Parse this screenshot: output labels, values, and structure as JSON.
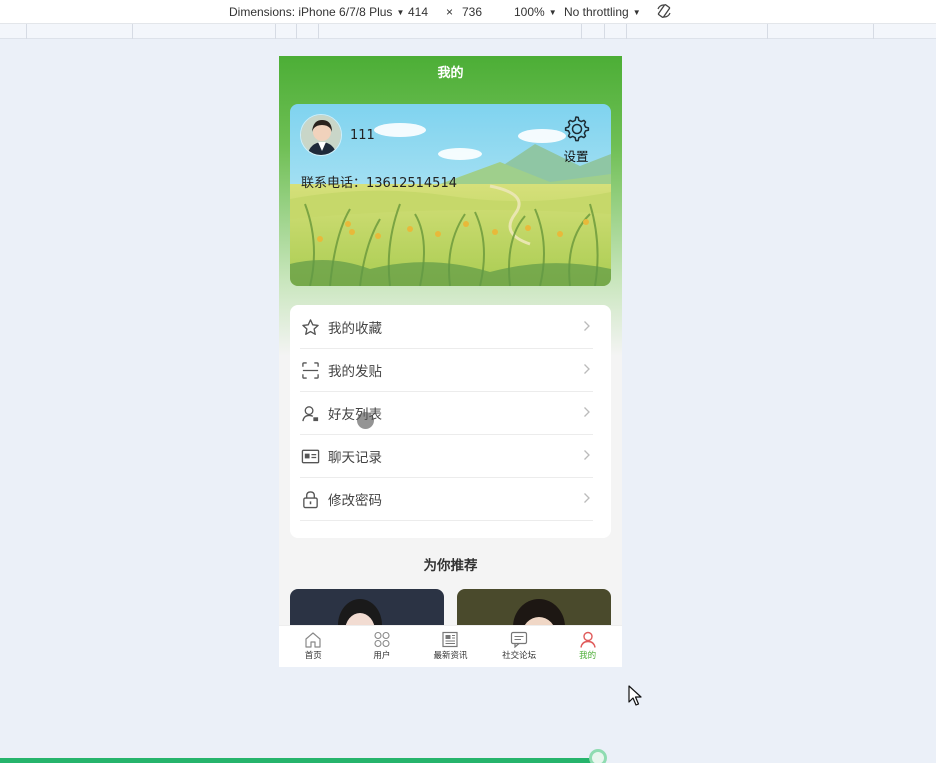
{
  "devtools": {
    "dimensions_label": "Dimensions: iPhone 6/7/8 Plus",
    "width": "414",
    "times": "×",
    "height": "736",
    "zoom": "100%",
    "throttling": "No throttling"
  },
  "header": {
    "title": "我的"
  },
  "profile": {
    "username": "111",
    "phone_label": "联系电话：",
    "phone": "13612514514",
    "settings_label": "设置"
  },
  "menu": {
    "items": [
      {
        "label": "我的收藏",
        "icon": "star-icon"
      },
      {
        "label": "我的发贴",
        "icon": "scan-icon"
      },
      {
        "label": "好友列表",
        "icon": "user-friends-icon"
      },
      {
        "label": "聊天记录",
        "icon": "id-card-icon"
      },
      {
        "label": "修改密码",
        "icon": "lock-icon"
      }
    ]
  },
  "recommend": {
    "title": "为你推荐"
  },
  "tabbar": {
    "items": [
      {
        "label": "首页",
        "icon": "home-icon",
        "active": false
      },
      {
        "label": "用户",
        "icon": "grid-icon",
        "active": false
      },
      {
        "label": "最新资讯",
        "icon": "news-icon",
        "active": false
      },
      {
        "label": "社交论坛",
        "icon": "chat-icon",
        "active": false
      },
      {
        "label": "我的",
        "icon": "person-icon",
        "active": true
      }
    ]
  },
  "colors": {
    "brand_green": "#4cae36",
    "active_tab": "#4cae36",
    "progress": "#26b46c"
  }
}
